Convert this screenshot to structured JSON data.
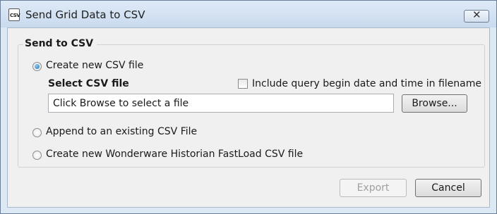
{
  "window": {
    "title": "Send Grid Data to CSV",
    "icon_text": "CSV",
    "close_glyph": "✕"
  },
  "group": {
    "title": "Send to CSV",
    "options": [
      {
        "label": "Create new CSV file",
        "checked": true
      },
      {
        "label": "Append to an existing CSV File",
        "checked": false
      },
      {
        "label": "Create new Wonderware Historian FastLoad CSV file",
        "checked": false
      }
    ],
    "select_csv_label": "Select CSV file",
    "include_datetime_label": "Include query begin date and time in filename",
    "file_field_value": "Click Browse to select a file",
    "browse_label": "Browse..."
  },
  "footer": {
    "export_label": "Export",
    "cancel_label": "Cancel"
  }
}
